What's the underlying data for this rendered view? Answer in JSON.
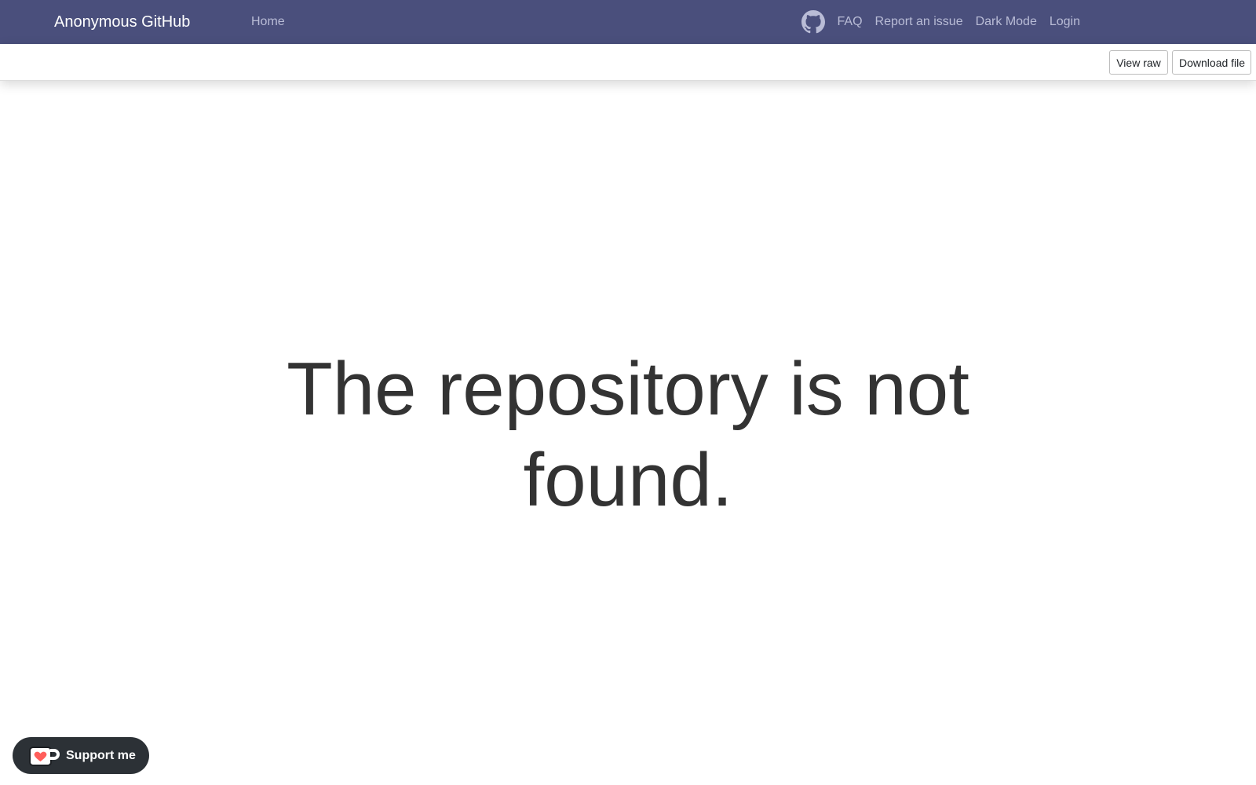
{
  "navbar": {
    "brand": "Anonymous GitHub",
    "home": "Home",
    "links": {
      "faq": "FAQ",
      "report": "Report an issue",
      "dark_mode": "Dark Mode",
      "login": "Login"
    },
    "icons": {
      "github": "github-icon"
    },
    "background_color": "#4a4f7c",
    "link_color": "#b9bcd6"
  },
  "toolbar": {
    "view_raw": "View raw",
    "download": "Download file"
  },
  "main": {
    "message": "The repository is not found."
  },
  "support": {
    "label": "Support me",
    "icon": "kofi-cup-icon",
    "background_color": "#2c3136",
    "heart_color": "#ff5e5b"
  }
}
